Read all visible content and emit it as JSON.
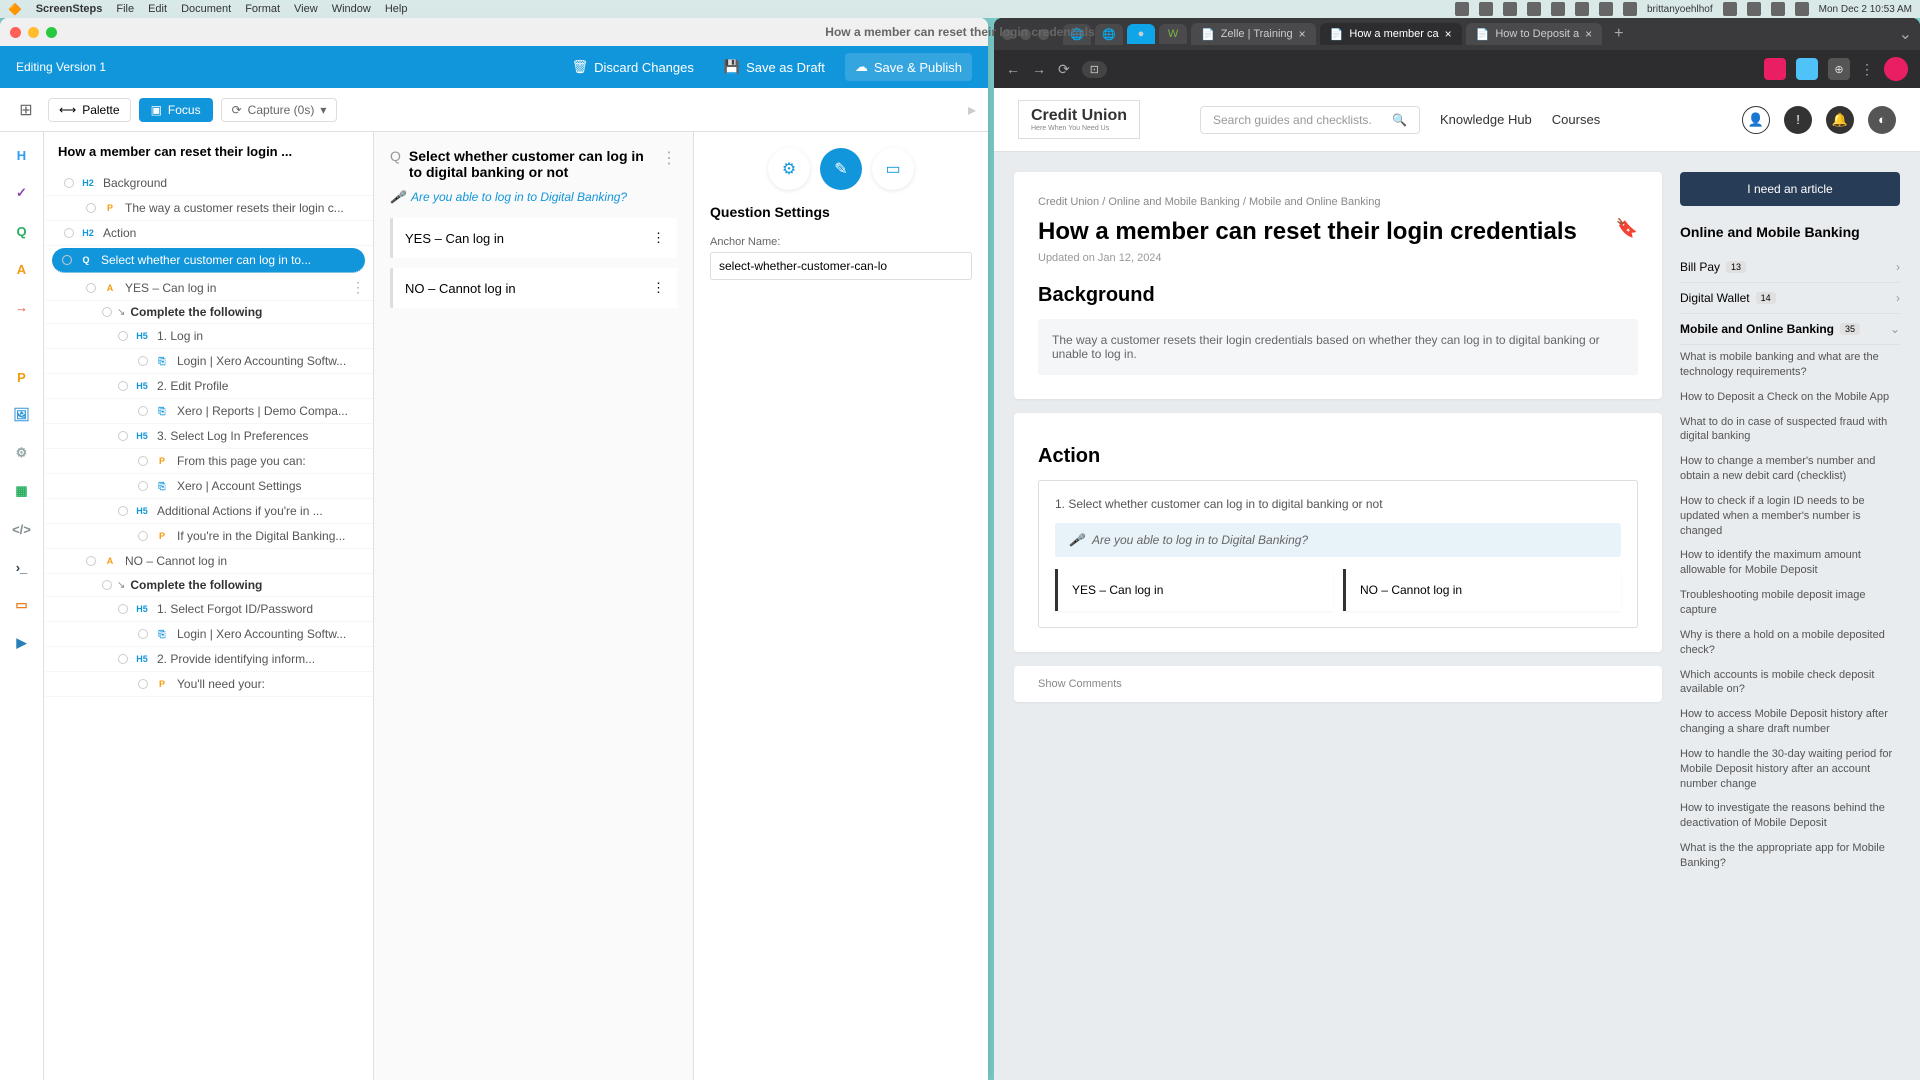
{
  "menubar": {
    "app": "ScreenSteps",
    "items": [
      "File",
      "Edit",
      "Document",
      "Format",
      "View",
      "Window",
      "Help"
    ],
    "user": "brittanyoehlhof",
    "datetime": "Mon Dec 2  10:53 AM"
  },
  "leftWindow": {
    "title": "How a member can reset their login credentials",
    "version": "Editing Version 1",
    "actions": {
      "discard": "Discard Changes",
      "draft": "Save as Draft",
      "publish": "Save & Publish"
    },
    "toolbar": {
      "palette": "Palette",
      "focus": "Focus",
      "capture": "Capture (0s)"
    },
    "outlineTitle": "How a member can reset their login ...",
    "outline": [
      {
        "icon": "H2",
        "text": "Background",
        "lvl": 1
      },
      {
        "icon": "P",
        "text": "The way a customer resets their login c...",
        "lvl": 2
      },
      {
        "icon": "H2",
        "text": "Action",
        "lvl": 1
      },
      {
        "icon": "Q",
        "text": "Select whether customer can log in to...",
        "lvl": 1,
        "selected": true
      },
      {
        "icon": "A",
        "text": "YES – Can log in",
        "lvl": 2,
        "dots": true
      },
      {
        "icon": "→",
        "text": "Complete the following",
        "lvl": 3,
        "bold": true
      },
      {
        "icon": "H5",
        "text": "1. Log in",
        "lvl": 4
      },
      {
        "icon": "⎘",
        "text": "Login | Xero Accounting Softw...",
        "lvl": 5
      },
      {
        "icon": "H5",
        "text": "2. Edit Profile",
        "lvl": 4
      },
      {
        "icon": "⎘",
        "text": "Xero | Reports | Demo Compa...",
        "lvl": 5
      },
      {
        "icon": "H5",
        "text": "3. Select Log In Preferences",
        "lvl": 4
      },
      {
        "icon": "P",
        "text": "From this page you can:",
        "lvl": 5
      },
      {
        "icon": "⎘",
        "text": "Xero | Account Settings",
        "lvl": 5
      },
      {
        "icon": "H5",
        "text": "Additional Actions if you're in ...",
        "lvl": 4
      },
      {
        "icon": "P",
        "text": "If you're in the Digital Banking...",
        "lvl": 5
      },
      {
        "icon": "A",
        "text": "NO – Cannot log in",
        "lvl": 2
      },
      {
        "icon": "→",
        "text": "Complete the following",
        "lvl": 3,
        "bold": true
      },
      {
        "icon": "H5",
        "text": "1. Select Forgot ID/Password",
        "lvl": 4
      },
      {
        "icon": "⎘",
        "text": "Login | Xero Accounting Softw...",
        "lvl": 5
      },
      {
        "icon": "H5",
        "text": "2. Provide identifying inform...",
        "lvl": 4
      },
      {
        "icon": "P",
        "text": "You'll need your:",
        "lvl": 5
      }
    ],
    "editor": {
      "title": "Select whether customer can log in to digital banking or not",
      "prompt": "Are you able to log in to Digital Banking?",
      "answers": [
        "YES – Can log in",
        "NO – Cannot log in"
      ]
    },
    "settings": {
      "title": "Question Settings",
      "anchorLabel": "Anchor Name:",
      "anchorValue": "select-whether-customer-can-lo"
    }
  },
  "browser": {
    "tabs": [
      {
        "label": "Zelle | Training",
        "close": true
      },
      {
        "label": "How a member ca",
        "active": true,
        "close": true
      },
      {
        "label": "How to Deposit a",
        "close": true
      }
    ]
  },
  "site": {
    "logo": "Credit Union",
    "tagline": "Here When You Need Us",
    "searchPlaceholder": "Search guides and checklists.",
    "nav": [
      "Knowledge Hub",
      "Courses"
    ]
  },
  "article": {
    "breadcrumbs": [
      "Credit Union",
      "Online and Mobile Banking",
      "Mobile and Online Banking"
    ],
    "title": "How a member can reset their login credentials",
    "updated": "Updated on Jan 12, 2024",
    "bgHeading": "Background",
    "bgText": "The way a customer resets their login credentials based on whether they can log in to digital banking or unable to log in.",
    "actionHeading": "Action",
    "step": "1. Select whether customer can log in to digital banking or not",
    "prompt": "Are you able to log in to Digital Banking?",
    "ansYes": "YES – Can log in",
    "ansNo": "NO – Cannot log in",
    "comments": "Show Comments"
  },
  "sidebar": {
    "cta": "I need an article",
    "title": "Online and Mobile Banking",
    "cats": [
      {
        "name": "Bill Pay",
        "count": "13"
      },
      {
        "name": "Digital Wallet",
        "count": "14"
      },
      {
        "name": "Mobile and Online Banking",
        "count": "35",
        "open": true
      }
    ],
    "links": [
      "What is mobile banking and what are the technology requirements?",
      "How to Deposit a Check on the Mobile App",
      "What to do in case of suspected fraud with digital banking",
      "How to change a member's number and obtain a new debit card (checklist)",
      "How to check if a login ID needs to be updated when a member's number is changed",
      "How to identify the maximum amount allowable for Mobile Deposit",
      "Troubleshooting mobile deposit image capture",
      "Why is there a hold on a mobile deposited check?",
      "Which accounts is mobile check deposit available on?",
      "How to access Mobile Deposit history after changing a share draft number",
      "How to handle the 30-day waiting period for Mobile Deposit history after an account number change",
      "How to investigate the reasons behind the deactivation of Mobile Deposit",
      "What is the the appropriate app for Mobile Banking?"
    ]
  }
}
